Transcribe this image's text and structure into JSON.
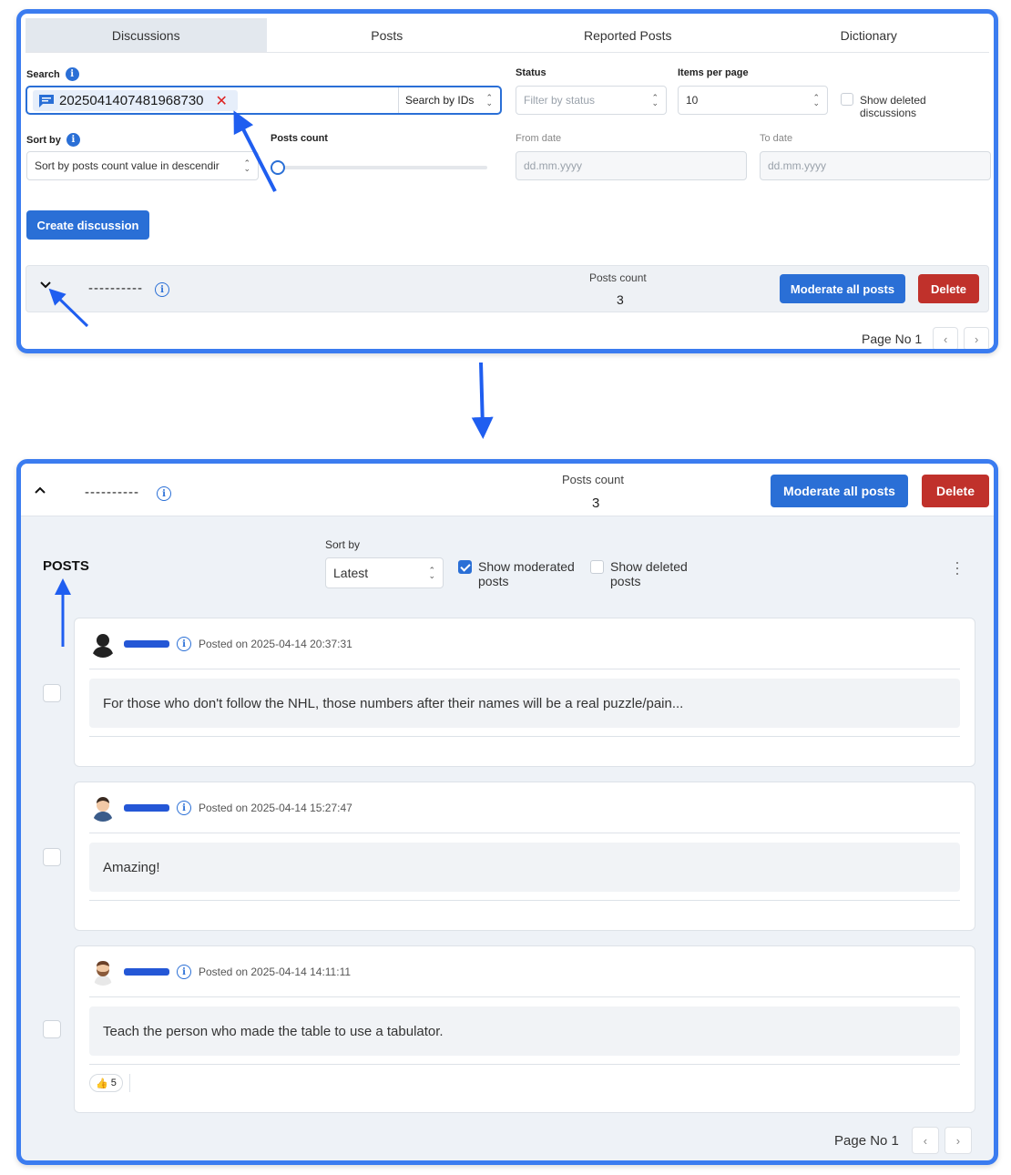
{
  "tabs": [
    "Discussions",
    "Posts",
    "Reported Posts",
    "Dictionary"
  ],
  "filters": {
    "search_label": "Search",
    "search_chip_value": "2025041407481968730",
    "search_mode": "Search by IDs",
    "status_label": "Status",
    "status_placeholder": "Filter by status",
    "items_label": "Items per page",
    "items_value": "10",
    "show_deleted_label": "Show deleted discussions",
    "sort_label": "Sort by",
    "sort_value": "Sort by posts count value in descendir",
    "posts_count_label": "Posts count",
    "from_label": "From date",
    "from_placeholder": "dd.mm.yyyy",
    "to_label": "To date",
    "to_placeholder": "dd.mm.yyyy"
  },
  "create_button": "Create discussion",
  "discussion": {
    "title": "----------",
    "posts_count_label": "Posts count",
    "posts_count": "3",
    "moderate_button": "Moderate all posts",
    "delete_button": "Delete"
  },
  "pager": {
    "label": "Page No 1"
  },
  "posts_panel": {
    "title": "POSTS",
    "sort_label": "Sort by",
    "sort_value": "Latest",
    "show_moderated": "Show moderated posts",
    "show_deleted": "Show deleted posts",
    "show_moderated_checked": true,
    "show_deleted_checked": false
  },
  "posts": [
    {
      "date": "Posted on 2025-04-14 20:37:31",
      "text": "For those who don't follow the NHL, those numbers after their names will be a real puzzle/pain...",
      "avatar": "silhouette-avatar"
    },
    {
      "date": "Posted on 2025-04-14 15:27:47",
      "text": "Amazing!",
      "avatar": "man-avatar"
    },
    {
      "date": "Posted on 2025-04-14 14:11:11",
      "text": "Teach the person who made the table to use a tabulator.",
      "avatar": "bearded-man-avatar",
      "reaction_icon": "thumbs-up-icon",
      "reaction_count": "5"
    }
  ],
  "colors": {
    "accent": "#2a6fd6",
    "danger": "#c0312b",
    "annotation_arrow": "#1f5ef0"
  }
}
